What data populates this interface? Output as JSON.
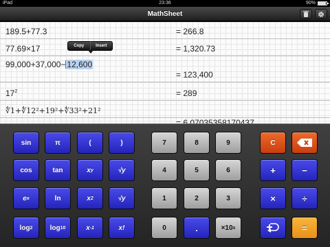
{
  "status": {
    "carrier": "iPad",
    "time": "23:36",
    "battery": "90%",
    "battery_level": 0.9
  },
  "nav": {
    "title": "MathSheet",
    "trash_icon": "trash-icon",
    "gear_icon": "gear-icon"
  },
  "sheet": {
    "line1": {
      "expr": "189.5+77.3",
      "result": "= 266.8"
    },
    "line2": {
      "expr": "77.69×17",
      "result": "= 1,320.73"
    },
    "line3": {
      "expr_before": "99,000+37,000−",
      "expr_selected": "12,600",
      "result": "= 123,400"
    },
    "line4": {
      "base": "17",
      "exponent": "2",
      "result": "= 289"
    },
    "line5": {
      "expr": "∜1+∜12²+19²+∜33²+21²",
      "result_partial": "= 6.07035358170437"
    },
    "popup": {
      "copy": "Copy",
      "insert": "Insert"
    }
  },
  "keys": {
    "sin": "sin",
    "pi": "π",
    "lparen": "(",
    "rparen": ")",
    "cos": "cos",
    "tan": "tan",
    "pow_base": "x",
    "pow_exp": "y",
    "root": "√y",
    "e_base": "e",
    "e_exp": "x",
    "ln": "ln",
    "sq_base": "x",
    "sq_exp": "2",
    "sqrt": "√y",
    "log2": "log",
    "log2_sub": "2",
    "log10": "log",
    "log10_sub": "10",
    "inv_base": "x",
    "inv_exp": "-1",
    "fact": "x!",
    "n7": "7",
    "n8": "8",
    "n9": "9",
    "n4": "4",
    "n5": "5",
    "n6": "6",
    "n1": "1",
    "n2": "2",
    "n3": "3",
    "n0": "0",
    "dot": ".",
    "exp10": "×10",
    "exp10_sup": "x",
    "clear": "C",
    "plus": "+",
    "minus": "−",
    "times": "×",
    "divide": "÷",
    "equals": "="
  }
}
